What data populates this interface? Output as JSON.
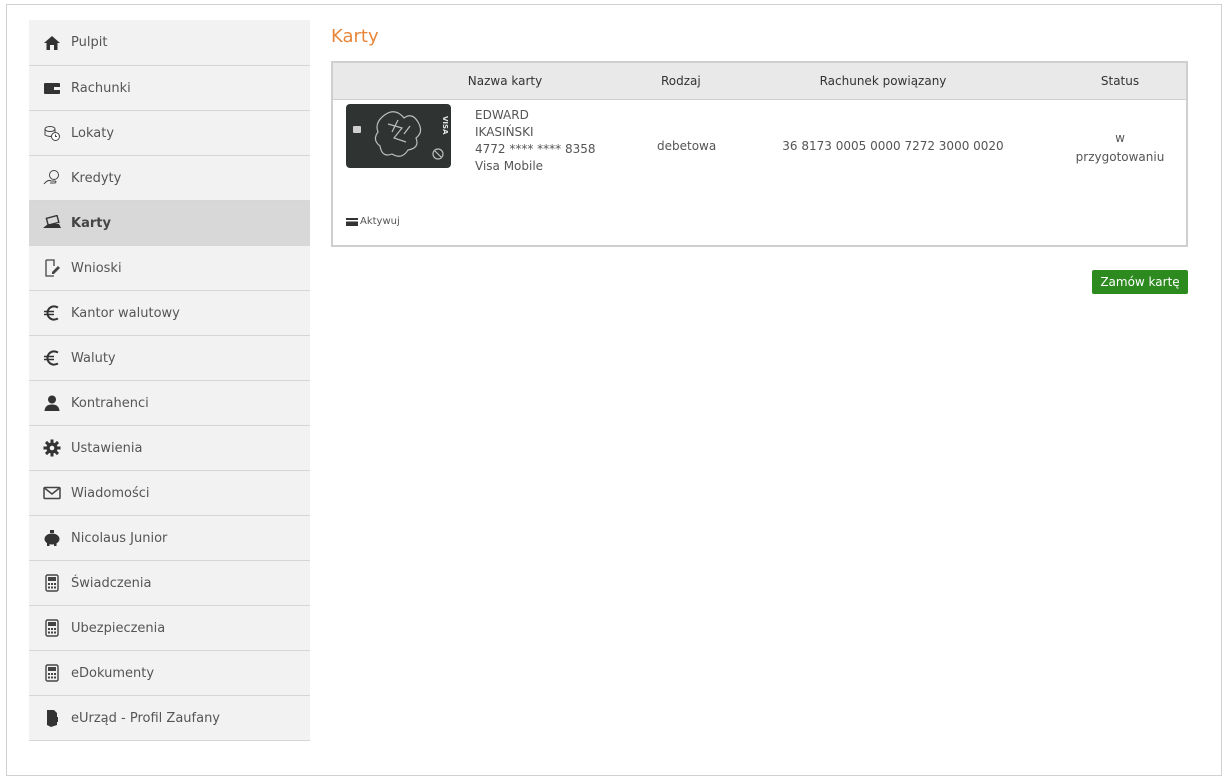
{
  "sidebar": {
    "items": [
      {
        "label": "Pulpit",
        "icon": "home-icon"
      },
      {
        "label": "Rachunki",
        "icon": "wallet-icon"
      },
      {
        "label": "Lokaty",
        "icon": "coins-clock-icon"
      },
      {
        "label": "Kredyty",
        "icon": "hand-coin-icon"
      },
      {
        "label": "Karty",
        "icon": "card-hand-icon",
        "active": true
      },
      {
        "label": "Wnioski",
        "icon": "document-pen-icon"
      },
      {
        "label": "Kantor walutowy",
        "icon": "euro-icon"
      },
      {
        "label": "Waluty",
        "icon": "euro-icon"
      },
      {
        "label": "Kontrahenci",
        "icon": "person-icon"
      },
      {
        "label": "Ustawienia",
        "icon": "gear-icon"
      },
      {
        "label": "Wiadomości",
        "icon": "envelope-icon"
      },
      {
        "label": "Nicolaus Junior",
        "icon": "piggy-bank-icon"
      },
      {
        "label": "Świadczenia",
        "icon": "calculator-icon"
      },
      {
        "label": "Ubezpieczenia",
        "icon": "calculator-icon"
      },
      {
        "label": "eDokumenty",
        "icon": "calculator-icon"
      },
      {
        "label": "eUrząd - Profil Zaufany",
        "icon": "id-badge-icon"
      }
    ]
  },
  "main": {
    "title": "Karty",
    "table": {
      "headers": [
        "Nazwa karty",
        "Rodzaj",
        "Rachunek powiązany",
        "Status"
      ],
      "row": {
        "holder_line1": "EDWARD",
        "holder_line2": "IKASIŃSKI",
        "card_number": "4772 **** **** 8358",
        "card_name": "Visa Mobile",
        "type": "debetowa",
        "account": "36 8173 0005 0000 7272 3000 0020",
        "status_line1": "w",
        "status_line2": "przygotowaniu",
        "card_brand": "VISA"
      },
      "activate_label": "Aktywuj"
    },
    "order_button": "Zamów kartę"
  },
  "colors": {
    "title_accent": "#e8863b",
    "button_green": "#2c8a1f",
    "card_dark": "#2f3433"
  }
}
